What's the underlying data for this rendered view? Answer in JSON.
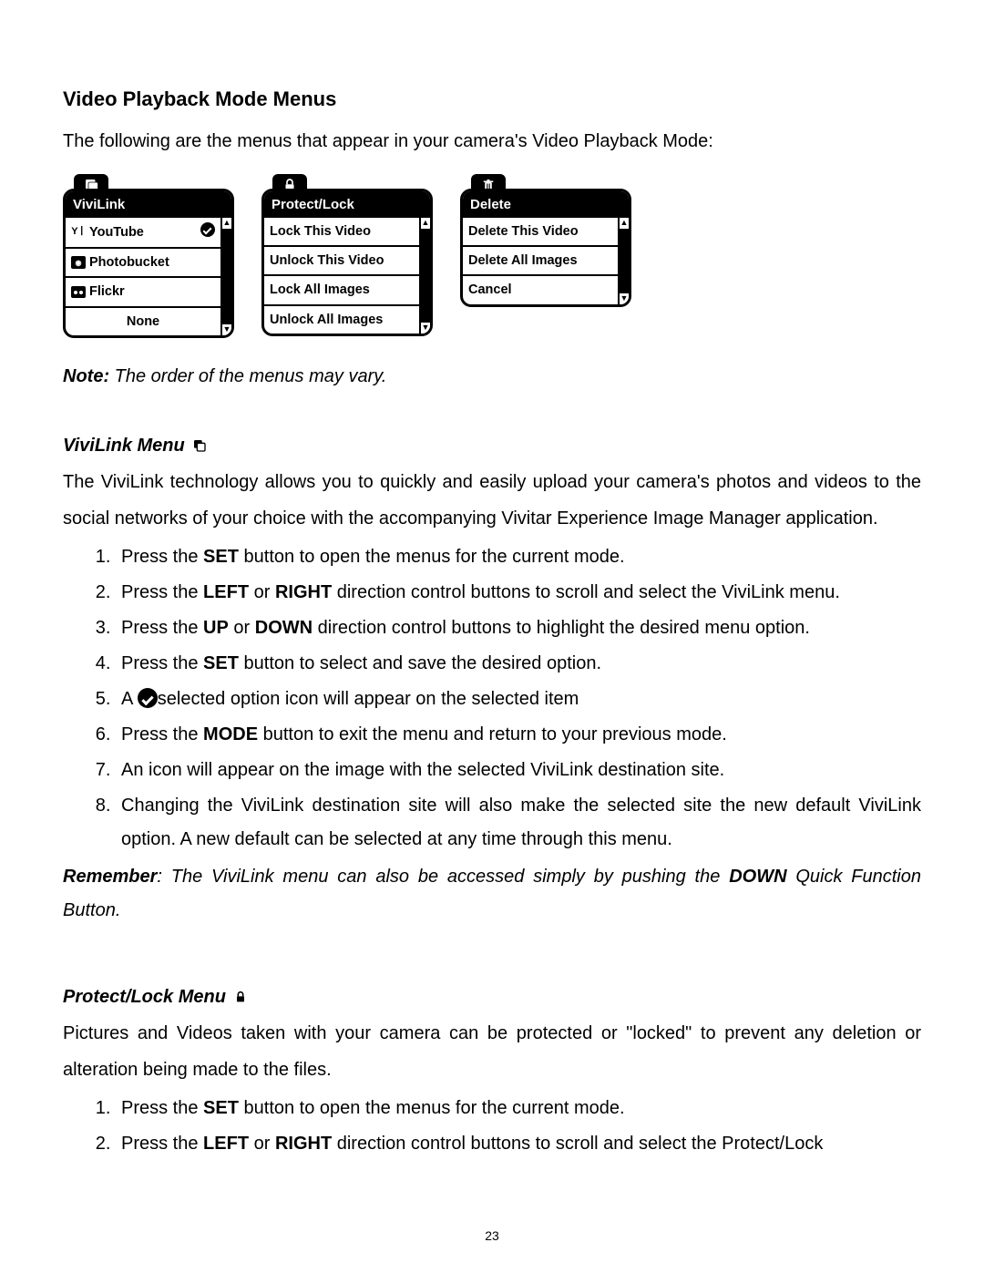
{
  "title": "Video Playback Mode Menus",
  "intro": "The following are the menus that appear in your camera's Video Playback Mode:",
  "menus": {
    "vivilink": {
      "header": "ViviLink",
      "items": [
        "YouTube",
        "Photobucket",
        "Flickr",
        "None"
      ]
    },
    "protect": {
      "header": "Protect/Lock",
      "items": [
        "Lock This Video",
        "Unlock This Video",
        "Lock All Images",
        "Unlock All Images"
      ]
    },
    "delete": {
      "header": "Delete",
      "items": [
        "Delete This Video",
        "Delete All Images",
        "Cancel"
      ]
    }
  },
  "note": {
    "label": "Note:",
    "text": " The order of the menus may vary."
  },
  "vivilink_section": {
    "heading": "ViviLink Menu",
    "para": "The ViviLink technology allows you to quickly and easily upload your camera's photos and videos to the social networks of your choice with the accompanying Vivitar Experience Image Manager application.",
    "steps": {
      "s1a": "Press the ",
      "s1b": "SET",
      "s1c": " button to open the menus for the current mode.",
      "s2a": "Press the ",
      "s2b": "LEFT",
      "s2c": " or ",
      "s2d": "RIGHT",
      "s2e": " direction control buttons to scroll and select the ViviLink menu.",
      "s3a": "Press the ",
      "s3b": "UP",
      "s3c": " or ",
      "s3d": "DOWN",
      "s3e": " direction control buttons to highlight the desired menu option.",
      "s4a": "Press the ",
      "s4b": "SET",
      "s4c": " button to select and save the desired option.",
      "s5a": "A ",
      "s5b": "selected option icon will appear on the selected item",
      "s6a": "Press the ",
      "s6b": "MODE",
      "s6c": " button to exit the menu and return to your previous mode.",
      "s7": "An icon will appear on the image with the selected ViviLink destination site.",
      "s8": "Changing the ViviLink destination site will also make the selected site the new default ViviLink option. A new default can be selected at any time through this menu."
    },
    "remember": {
      "label": "Remember",
      "colon": ":",
      "t1": "   The ViviLink menu can also be accessed simply by pushing the ",
      "t2": "DOWN",
      "t3": " Quick Function Button."
    }
  },
  "protect_section": {
    "heading": "Protect/Lock Menu",
    "para": "Pictures and Videos taken with your camera can be protected or \"locked\" to prevent any deletion or alteration being made to the files.",
    "steps": {
      "s1a": "Press the ",
      "s1b": "SET",
      "s1c": " button to open the menus for the current mode.",
      "s2a": "Press the ",
      "s2b": "LEFT",
      "s2c": " or ",
      "s2d": "RIGHT",
      "s2e": " direction control buttons to scroll and select the Protect/Lock"
    }
  },
  "page_number": "23"
}
